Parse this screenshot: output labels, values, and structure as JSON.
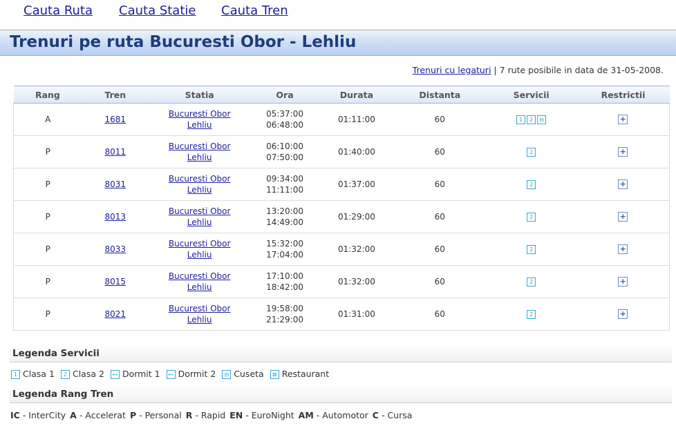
{
  "nav": {
    "links": [
      {
        "label": "Cauta Ruta"
      },
      {
        "label": "Cauta Statie"
      },
      {
        "label": "Cauta Tren"
      }
    ]
  },
  "title": "Trenuri pe ruta Bucuresti Obor - Lehliu",
  "info": {
    "link": "Trenuri cu legaturi",
    "separator": "|",
    "text": "7 rute posibile in data de 31-05-2008."
  },
  "table": {
    "headers": [
      "Rang",
      "Tren",
      "Statia",
      "Ora",
      "Durata",
      "Distanta",
      "Servicii",
      "Restrictii"
    ],
    "rows": [
      {
        "rang": "A",
        "tren": "1681",
        "from": "Bucuresti Obor",
        "to": "Lehliu",
        "dep": "05:37:00",
        "arr": "06:48:00",
        "durata": "01:11:00",
        "distanta": "60",
        "servicii": [
          "1",
          "2",
          "cuseta"
        ]
      },
      {
        "rang": "P",
        "tren": "8011",
        "from": "Bucuresti Obor",
        "to": "Lehliu",
        "dep": "06:10:00",
        "arr": "07:50:00",
        "durata": "01:40:00",
        "distanta": "60",
        "servicii": [
          "2"
        ]
      },
      {
        "rang": "P",
        "tren": "8031",
        "from": "Bucuresti Obor",
        "to": "Lehliu",
        "dep": "09:34:00",
        "arr": "11:11:00",
        "durata": "01:37:00",
        "distanta": "60",
        "servicii": [
          "2"
        ]
      },
      {
        "rang": "P",
        "tren": "8013",
        "from": "Bucuresti Obor",
        "to": "Lehliu",
        "dep": "13:20:00",
        "arr": "14:49:00",
        "durata": "01:29:00",
        "distanta": "60",
        "servicii": [
          "2"
        ]
      },
      {
        "rang": "P",
        "tren": "8033",
        "from": "Bucuresti Obor",
        "to": "Lehliu",
        "dep": "15:32:00",
        "arr": "17:04:00",
        "durata": "01:32:00",
        "distanta": "60",
        "servicii": [
          "2"
        ]
      },
      {
        "rang": "P",
        "tren": "8015",
        "from": "Bucuresti Obor",
        "to": "Lehliu",
        "dep": "17:10:00",
        "arr": "18:42:00",
        "durata": "01:32:00",
        "distanta": "60",
        "servicii": [
          "2"
        ]
      },
      {
        "rang": "P",
        "tren": "8021",
        "from": "Bucuresti Obor",
        "to": "Lehliu",
        "dep": "19:58:00",
        "arr": "21:29:00",
        "durata": "01:31:00",
        "distanta": "60",
        "servicii": [
          "2"
        ]
      }
    ],
    "restriction_icon": "+"
  },
  "legend_servicii": {
    "title": "Legenda Servicii",
    "items": [
      {
        "icon": "1",
        "label": "Clasa 1"
      },
      {
        "icon": "2",
        "label": "Clasa 2"
      },
      {
        "icon": "dormit1",
        "label": "Dormit 1"
      },
      {
        "icon": "dormit2",
        "label": "Dormit 2"
      },
      {
        "icon": "cuseta",
        "label": "Cuseta"
      },
      {
        "icon": "restaurant",
        "label": "Restaurant"
      }
    ]
  },
  "legend_rang": {
    "title": "Legenda Rang Tren",
    "items": [
      {
        "code": "IC",
        "label": "- InterCity"
      },
      {
        "code": "A",
        "label": "- Accelerat"
      },
      {
        "code": "P",
        "label": "- Personal"
      },
      {
        "code": "R",
        "label": "- Rapid"
      },
      {
        "code": "EN",
        "label": "- EuroNight"
      },
      {
        "code": "AM",
        "label": "- Automotor"
      },
      {
        "code": "C",
        "label": "- Cursa"
      }
    ]
  },
  "icons": {
    "1": "1",
    "2": "2",
    "dormit1": "⊷",
    "dormit2": "⊷",
    "cuseta": "⊟",
    "restaurant": "⊠"
  },
  "colors": {
    "link": "#1c1c9c",
    "title": "#1f3d7a",
    "service_icon": "#3aa6cf"
  }
}
